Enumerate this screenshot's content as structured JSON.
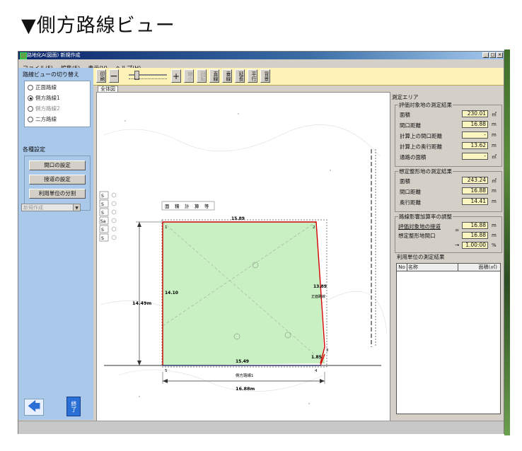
{
  "heading": "▼側方路線ビュー",
  "window": {
    "title": "路地化A(図面) 新規作成",
    "controls": [
      "_",
      "□",
      "×"
    ]
  },
  "menu": [
    "ファイル(F)",
    "編集(E)",
    "表示(V)",
    "ヘルプ(H)"
  ],
  "left_panel": {
    "switch_title": "路線ビューの切り替え",
    "radios": [
      {
        "label": "正面路線",
        "checked": false,
        "disabled": false
      },
      {
        "label": "側方路線1",
        "checked": true,
        "disabled": false
      },
      {
        "label": "側方路線2",
        "checked": false,
        "disabled": true
      },
      {
        "label": "二方路線",
        "checked": false,
        "disabled": false
      }
    ],
    "settings_title": "各種設定",
    "buttons": [
      "間口の設定",
      "接道の設定",
      "利用単位の分割"
    ],
    "select_value": "新規作成",
    "end_label": "終了"
  },
  "toolbar": {
    "print": "印刷",
    "minus": "−",
    "plus": "+",
    "buttons": [
      "縮小",
      "回転",
      "直線",
      "垂線",
      "延長",
      "平行",
      "背景"
    ],
    "tab": "全体図"
  },
  "drawing": {
    "top_len": "15.89",
    "left_len": "14.10",
    "right_len": "13.89",
    "right_note": "正面路線",
    "bottom_right_len": "1.85",
    "bottom_len": "15.49",
    "dim_left": "14.49m",
    "dim_bottom": "16.88m",
    "road_label": "側方路線1",
    "vertex_labels": [
      "1",
      "2",
      "3",
      "4",
      "5"
    ],
    "legend_text": [
      "面",
      "積",
      "計",
      "算",
      "等"
    ],
    "side_box_labels": [
      "S",
      "S",
      "S",
      "Sa",
      "S",
      "S"
    ]
  },
  "right_panel": {
    "title": "測定エリア",
    "eval_title": "評価対象地の測定結果",
    "eval_rows": [
      {
        "label": "面積",
        "value": "230.01",
        "unit": "㎡"
      },
      {
        "label": "間口距離",
        "value": "16.88",
        "unit": "m"
      },
      {
        "label": "計算上の間口距離",
        "value": "-",
        "unit": "m"
      },
      {
        "label": "計算上の奥行距離",
        "value": "13.62",
        "unit": "m"
      },
      {
        "label": "通路の面積",
        "value": "-",
        "unit": "㎡"
      }
    ],
    "assume_title": "想定整形地の測定結果",
    "assume_rows": [
      {
        "label": "面積",
        "value": "243.24",
        "unit": "㎡"
      },
      {
        "label": "間口距離",
        "value": "16.88",
        "unit": "m"
      },
      {
        "label": "奥行距離",
        "value": "14.41",
        "unit": "m"
      }
    ],
    "adjust_title": "路線影響加算率の調整",
    "adjust_rows": [
      {
        "label": "評価対象地の接道",
        "value": "16.88",
        "unit": "m"
      },
      {
        "label": "想定整形地間口",
        "value": "16.88",
        "unit": "m"
      }
    ],
    "adjust_eq": "=",
    "adjust_arrow": "→",
    "adjust_result": {
      "value": "1.00:00",
      "unit": "%"
    },
    "unit_title": "利用単位の測定結果",
    "grid_headers": [
      "No",
      "名称",
      "面積(㎡)"
    ]
  }
}
